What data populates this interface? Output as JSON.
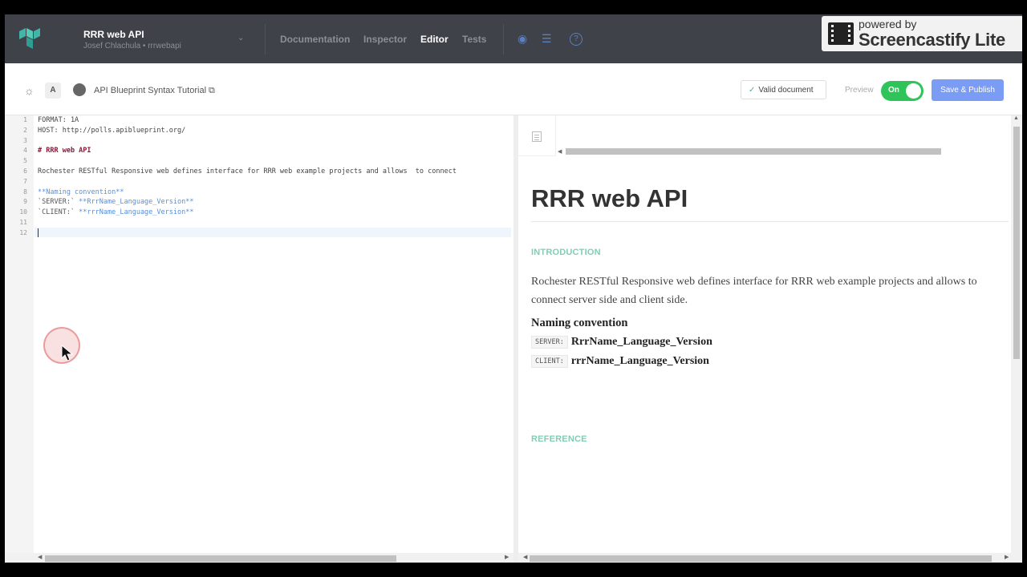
{
  "header": {
    "project_title": "RRR web API",
    "project_subtitle": "Josef Chlachula • rrrwebapi",
    "nav": {
      "documentation": "Documentation",
      "inspector": "Inspector",
      "editor": "Editor",
      "tests": "Tests"
    },
    "watermark_small": "powered by",
    "watermark_big": "Screencastify Lite"
  },
  "toolbar": {
    "font_button": "A",
    "tutorial_link": "API Blueprint Syntax Tutorial",
    "valid_label": "Valid document",
    "preview_label": "Preview",
    "toggle_label": "On",
    "publish_label": "Save & Publish"
  },
  "editor": {
    "line_numbers": [
      "1",
      "2",
      "3",
      "4",
      "5",
      "6",
      "7",
      "8",
      "9",
      "10",
      "11",
      "12"
    ],
    "lines": {
      "l1": "FORMAT: 1A",
      "l2": "HOST: http://polls.apiblueprint.org/",
      "l4": "# RRR web API",
      "l6": "Rochester RESTful Responsive web defines interface for RRR web example projects and allows  to connect",
      "l8": "**Naming convention**",
      "l9_key": "`SERVER:`",
      "l9_val": " **RrrName_Language_Version**",
      "l10_key": "`CLIENT:`",
      "l10_val": " **rrrName_Language_Version**"
    }
  },
  "preview": {
    "title": "RRR web API",
    "intro_heading": "INTRODUCTION",
    "intro_text": "Rochester RESTful Responsive web defines interface for RRR web example projects and allows to connect server side and client side.",
    "naming_heading": "Naming convention",
    "server_key": "SERVER:",
    "server_val": "RrrName_Language_Version",
    "client_key": "CLIENT:",
    "client_val": "rrrName_Language_Version",
    "reference_heading": "REFERENCE"
  },
  "colors": {
    "topbar": "#3f4248",
    "toggle_on": "#2fc45a",
    "publish": "#7b9cf5",
    "section_heading": "#7fcfb5",
    "markdown_heading": "#8b1a3a",
    "markdown_bold": "#5a8ed8"
  }
}
